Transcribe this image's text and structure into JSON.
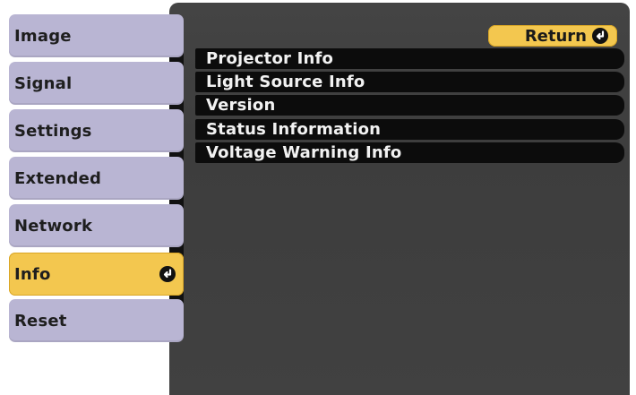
{
  "sidebar": {
    "items": [
      {
        "label": "Image",
        "active": false
      },
      {
        "label": "Signal",
        "active": false
      },
      {
        "label": "Settings",
        "active": false
      },
      {
        "label": "Extended",
        "active": false
      },
      {
        "label": "Network",
        "active": false
      },
      {
        "label": "Info",
        "active": true
      },
      {
        "label": "Reset",
        "active": false
      }
    ]
  },
  "panel": {
    "return_label": "Return",
    "items": [
      {
        "label": "Projector Info"
      },
      {
        "label": "Light Source Info"
      },
      {
        "label": "Version"
      },
      {
        "label": "Status Information"
      },
      {
        "label": "Voltage Warning Info"
      }
    ]
  },
  "icons": {
    "enter": "enter-icon"
  },
  "colors": {
    "sidebar_item": "#b9b5d3",
    "active": "#f3c74f",
    "panel_bg": "#424242",
    "list_row": "#0c0c0c",
    "list_text": "#f2f2f2"
  }
}
